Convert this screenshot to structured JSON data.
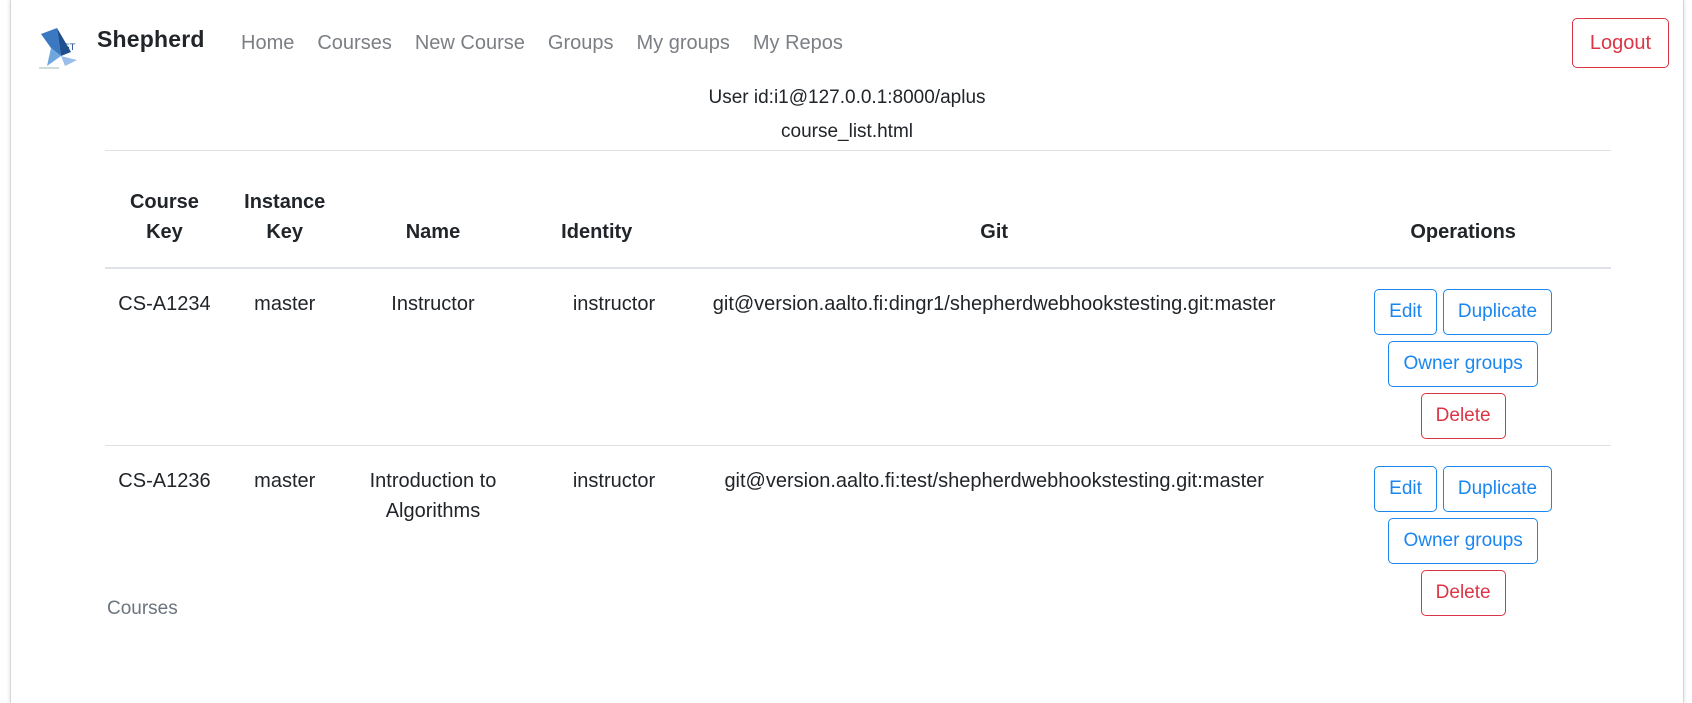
{
  "navbar": {
    "brand": "Shepherd",
    "links": [
      "Home",
      "Courses",
      "New Course",
      "Groups",
      "My groups",
      "My Repos"
    ],
    "logout_label": "Logout"
  },
  "info": {
    "user_id": "User id:i1@127.0.0.1:8000/aplus",
    "template": "course_list.html"
  },
  "table": {
    "headers": {
      "course_key": "Course Key",
      "instance_key": "Instance Key",
      "name": "Name",
      "identity": "Identity",
      "git": "Git",
      "operations": "Operations"
    },
    "rows": [
      {
        "course_key": "CS-A1234",
        "instance_key": "master",
        "name": "Instructor",
        "identity": "instructor",
        "git": "git@version.aalto.fi:dingr1/shepherdwebhookstesting.git:master"
      },
      {
        "course_key": "CS-A1236",
        "instance_key": "master",
        "name": "Introduction to Algorithms",
        "identity": "instructor",
        "git": "git@version.aalto.fi:test/shepherdwebhookstesting.git:master"
      }
    ],
    "operations": {
      "edit": "Edit",
      "duplicate": "Duplicate",
      "owner_groups": "Owner groups",
      "delete": "Delete"
    }
  },
  "footer": {
    "label": "Courses"
  },
  "colors": {
    "primary": "#1a86f0",
    "danger": "#dc3545",
    "muted": "#7b7f84"
  },
  "icons": {
    "logo": "shepherd-logo-icon"
  }
}
